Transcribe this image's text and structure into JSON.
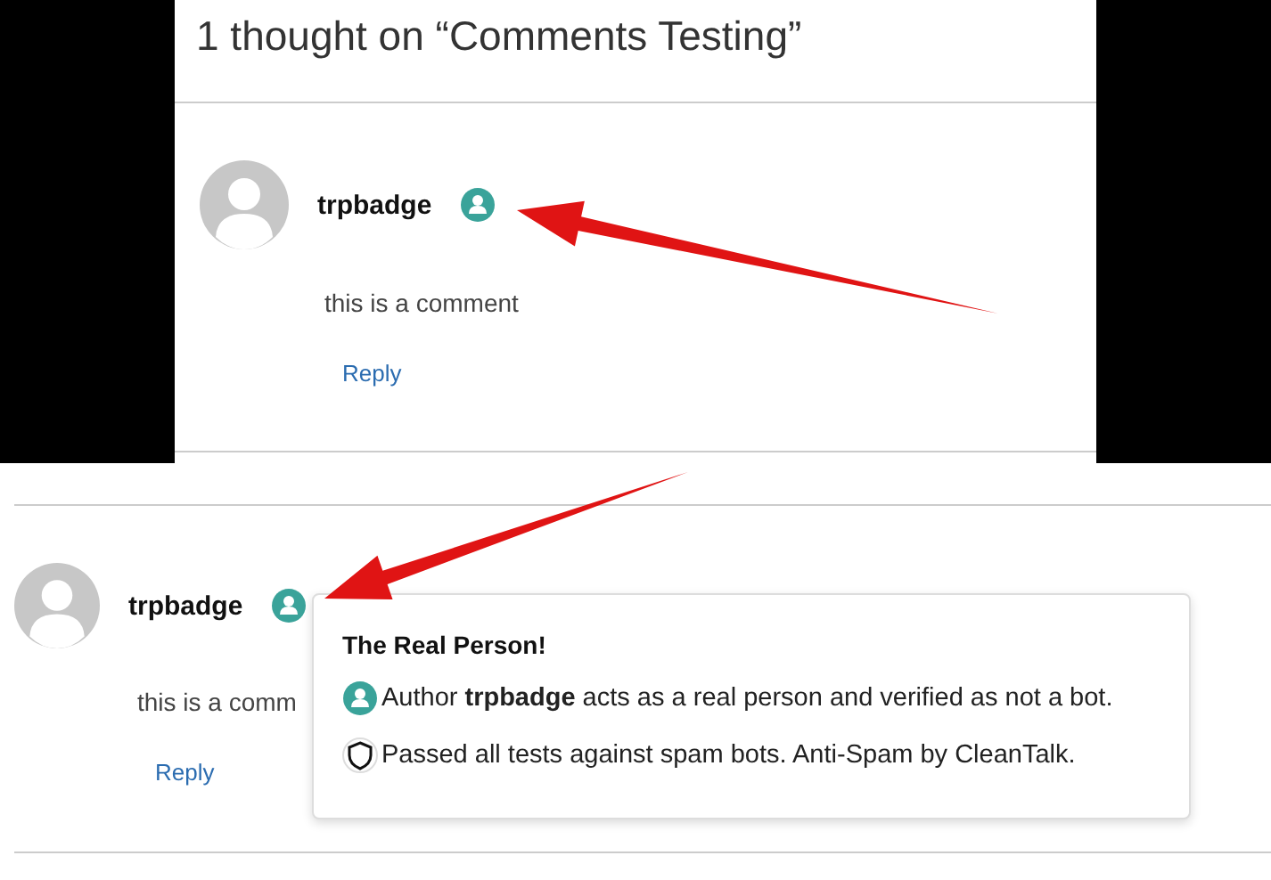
{
  "top_panel": {
    "title": "1 thought on “Comments Testing”",
    "comment": {
      "author": "trpbadge",
      "text": "this is a comment",
      "reply": "Reply"
    }
  },
  "bottom_panel": {
    "comment": {
      "author": "trpbadge",
      "text": "this is a comm",
      "reply": "Reply"
    },
    "tooltip": {
      "title": "The Real Person!",
      "lines": [
        {
          "kind": "person",
          "text": "Author **trpbadge** acts as a real person and verified as not a bot."
        },
        {
          "kind": "shield",
          "text": "Passed all tests against spam bots. Anti-Spam by CleanTalk."
        }
      ]
    }
  }
}
